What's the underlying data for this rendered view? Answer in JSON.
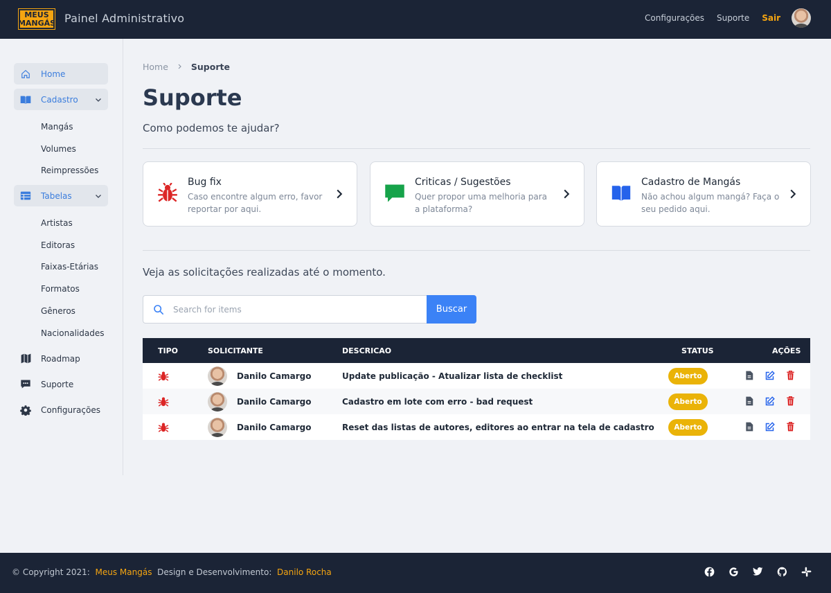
{
  "header": {
    "logo_line1": "MEUS",
    "logo_line2": "MANGÁS",
    "title": "Painel Administrativo",
    "nav": {
      "config": "Configurações",
      "support": "Suporte",
      "logout": "Sair"
    }
  },
  "sidebar": {
    "home": "Home",
    "cadastro": "Cadastro",
    "cadastro_items": [
      "Mangás",
      "Volumes",
      "Reimpressões"
    ],
    "tabelas": "Tabelas",
    "tabelas_items": [
      "Artistas",
      "Editoras",
      "Faixas-Etárias",
      "Formatos",
      "Gêneros",
      "Nacionalidades"
    ],
    "roadmap": "Roadmap",
    "suporte": "Suporte",
    "configuracoes": "Configurações"
  },
  "breadcrumb": {
    "home": "Home",
    "current": "Suporte"
  },
  "page": {
    "title": "Suporte",
    "subtitle": "Como podemos te ajudar?",
    "requests_label": "Veja as solicitações realizadas até o momento."
  },
  "cards": [
    {
      "title": "Bug fix",
      "desc": "Caso encontre algum erro, favor reportar por aqui.",
      "icon": "bug-icon",
      "color": "#dc2626"
    },
    {
      "title": "Criticas / Sugestões",
      "desc": "Quer propor uma melhoria para a plataforma?",
      "icon": "chat-icon",
      "color": "#16a34a"
    },
    {
      "title": "Cadastro de Mangás",
      "desc": "Não achou algum mangá? Faça o seu pedido aqui.",
      "icon": "book-icon",
      "color": "#2563eb"
    }
  ],
  "search": {
    "placeholder": "Search for items",
    "value": "",
    "button": "Buscar"
  },
  "table": {
    "headers": {
      "tipo": "TIPO",
      "solicitante": "SOLICITANTE",
      "descricao": "DESCRICAO",
      "status": "STATUS",
      "acoes": "AÇÕES"
    },
    "rows": [
      {
        "requester": "Danilo Camargo",
        "description": "Update publicação - Atualizar lista de checklist",
        "status": "Aberto"
      },
      {
        "requester": "Danilo Camargo",
        "description": "Cadastro em lote com erro - bad request",
        "status": "Aberto"
      },
      {
        "requester": "Danilo Camargo",
        "description": "Reset das listas de autores, editores ao entrar na tela de cadastro",
        "status": "Aberto"
      }
    ]
  },
  "footer": {
    "copyright": "© Copyright 2021:",
    "brand": "Meus Mangás",
    "credit_label": "Design e Desenvolvimento:",
    "author": "Danilo Rocha",
    "social_icons": [
      "facebook-icon",
      "google-icon",
      "twitter-icon",
      "github-icon",
      "slack-icon"
    ]
  },
  "colors": {
    "accent": "#f5a511",
    "primary": "#3b82f6",
    "dark": "#1b2436",
    "status_open": "#eab308",
    "bug": "#dc2626"
  }
}
